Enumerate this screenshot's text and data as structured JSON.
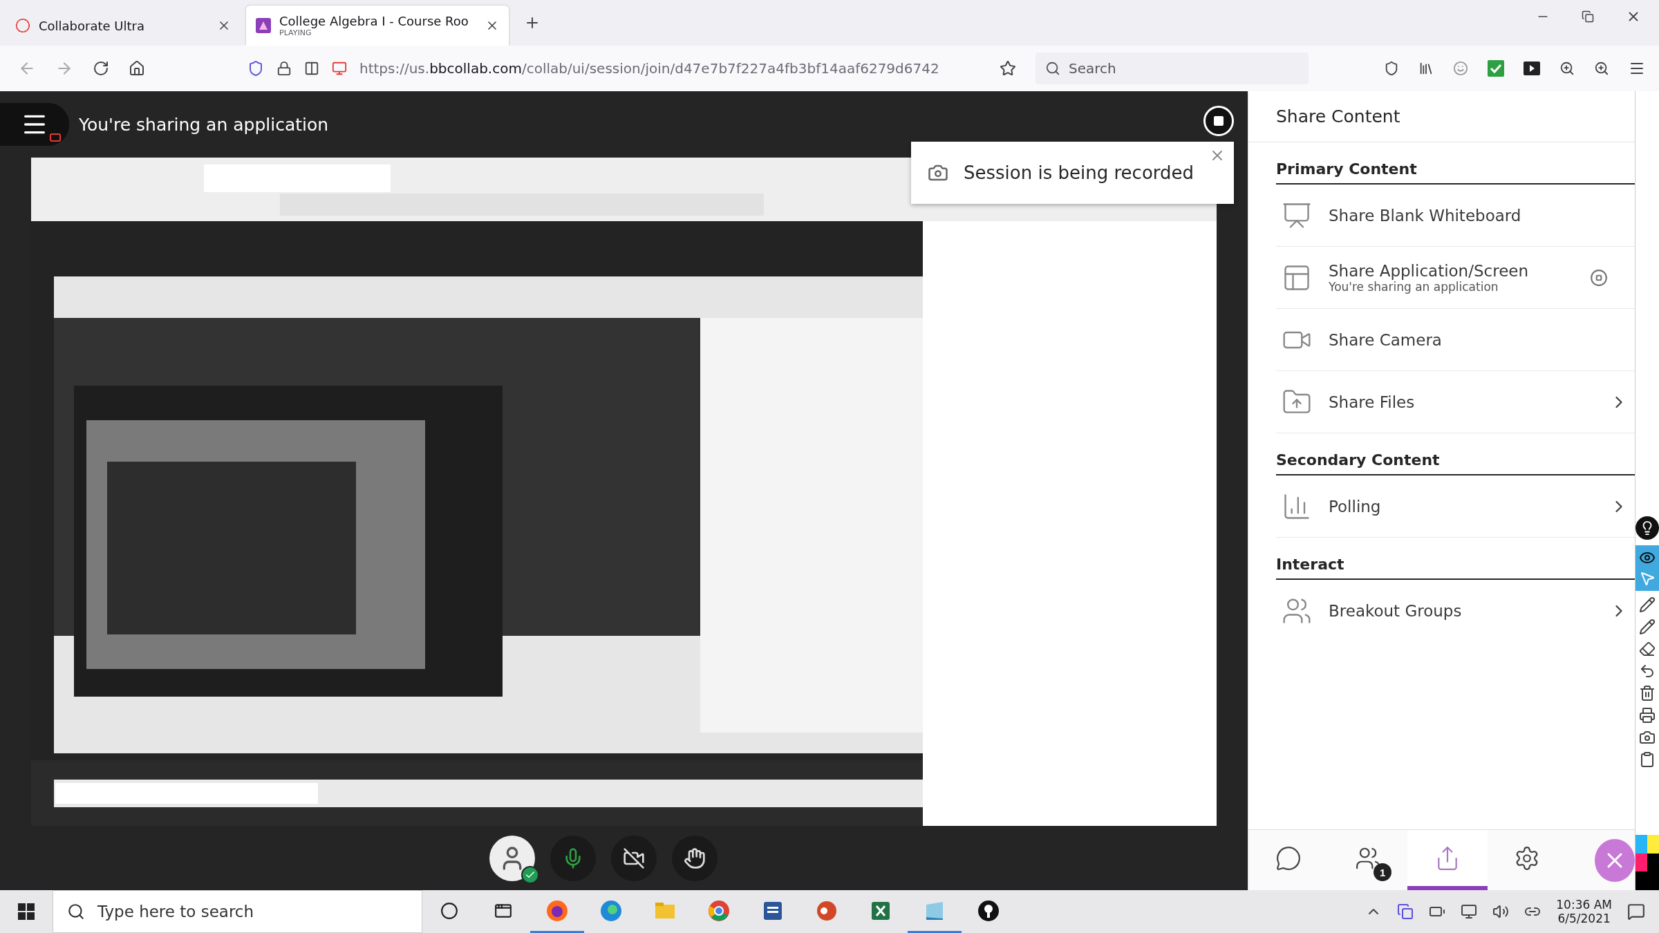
{
  "browser": {
    "tabs": [
      {
        "title": "Collaborate Ultra",
        "selected": false
      },
      {
        "title": "College Algebra I - Course Roo",
        "status": "PLAYING",
        "selected": true
      }
    ],
    "url": {
      "prefix": "https://us.",
      "host": "bbcollab.com",
      "path": "/collab/ui/session/join/d47e7b7f227a4fb3bf14aaf6279d6742"
    },
    "search": {
      "placeholder": "Search"
    }
  },
  "stage": {
    "banner": "You're sharing an application",
    "toast": "Session is being recorded"
  },
  "panel": {
    "title": "Share Content",
    "sections": [
      {
        "heading": "Primary Content",
        "items": [
          {
            "kind": "whiteboard",
            "label": "Share Blank Whiteboard"
          },
          {
            "kind": "screen",
            "label": "Share Application/Screen",
            "detail": "You're sharing an application",
            "stop_control": true
          },
          {
            "kind": "camera",
            "label": "Share Camera"
          },
          {
            "kind": "files",
            "label": "Share Files",
            "chevron": true
          }
        ]
      },
      {
        "heading": "Secondary Content",
        "items": [
          {
            "kind": "polling",
            "label": "Polling",
            "chevron": true
          }
        ]
      },
      {
        "heading": "Interact",
        "items": [
          {
            "kind": "breakout",
            "label": "Breakout Groups",
            "chevron": true
          }
        ]
      }
    ],
    "nav": [
      {
        "kind": "chat",
        "selected": false
      },
      {
        "kind": "people",
        "badge": "1",
        "selected": false
      },
      {
        "kind": "share",
        "selected": true
      },
      {
        "kind": "settings",
        "selected": false
      }
    ]
  },
  "taskbar": {
    "search": {
      "placeholder": "Type here to search"
    },
    "apps": [
      {
        "kind": "firefox",
        "running": true
      },
      {
        "kind": "edge",
        "running": false
      },
      {
        "kind": "explorer",
        "running": false
      },
      {
        "kind": "chrome",
        "running": false
      },
      {
        "kind": "word",
        "running": false
      },
      {
        "kind": "powerpoint",
        "running": false
      },
      {
        "kind": "excel",
        "running": false
      },
      {
        "kind": "remote",
        "running": true
      },
      {
        "kind": "pin",
        "running": false
      }
    ],
    "time": "10:36 AM",
    "date": "6/5/2021"
  }
}
